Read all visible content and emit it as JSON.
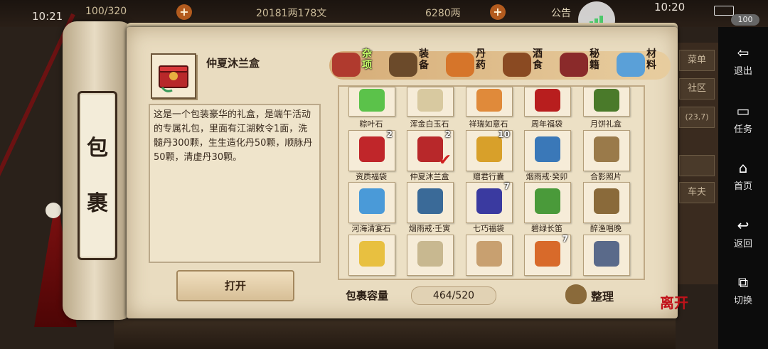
{
  "status_bar": {
    "time_left": "10:21",
    "time_right": "10:20",
    "battery": "100"
  },
  "hud": {
    "stamina": "100/320",
    "money": "20181两178文",
    "gold": "6280两",
    "announce": "公告"
  },
  "side_nav": [
    {
      "label": "退出",
      "icon": "exit-icon",
      "glyph": "⇦"
    },
    {
      "label": "任务",
      "icon": "tasks-icon",
      "glyph": "▭"
    },
    {
      "label": "首页",
      "icon": "home-icon",
      "glyph": "⌂"
    },
    {
      "label": "返回",
      "icon": "back-icon",
      "glyph": "↩"
    },
    {
      "label": "切换",
      "icon": "switch-icon",
      "glyph": "⧉"
    }
  ],
  "bg_tabs": [
    "菜单",
    "社区",
    "(23,7)",
    "",
    "车夫"
  ],
  "scroll": {
    "title_chars": [
      "包",
      "裹"
    ]
  },
  "selected_item": {
    "name": "仲夏沐兰盒",
    "description": "这是一个包装豪华的礼盒，是端午活动的专属礼包，里面有江湖敕令1面，洗髓丹300颗，生生造化丹50颗，顺脉丹50颗，清虚丹30颗。"
  },
  "open_button": "打开",
  "categories": [
    {
      "label": "杂项",
      "icon": "misc-jar-icon",
      "active": true,
      "color": "#b03a2e"
    },
    {
      "label": "装备",
      "icon": "equipment-weapon-icon",
      "active": false,
      "color": "#6b4a2a"
    },
    {
      "label": "丹药",
      "icon": "pill-plate-icon",
      "active": false,
      "color": "#d6752a"
    },
    {
      "label": "酒食",
      "icon": "wine-food-icon",
      "active": false,
      "color": "#8a4a22"
    },
    {
      "label": "秘籍",
      "icon": "scripture-book-icon",
      "active": false,
      "color": "#8a2a2a"
    },
    {
      "label": "材料",
      "icon": "crystal-material-icon",
      "active": false,
      "color": "#5aa0d8"
    }
  ],
  "grid_items": [
    {
      "name": "粽叶石",
      "count": "",
      "icon": "green-crystal-icon",
      "color": "#5bc24a",
      "selected": false
    },
    {
      "name": "浑金白玉石",
      "count": "",
      "icon": "white-jade-icon",
      "color": "#d8c9a0",
      "selected": false
    },
    {
      "name": "祥瑞如意石",
      "count": "",
      "icon": "flame-stone-icon",
      "color": "#e08a3a",
      "selected": false
    },
    {
      "name": "周年福袋",
      "count": "",
      "icon": "red-pouch-icon",
      "color": "#b81e1e",
      "selected": false
    },
    {
      "name": "月饼礼盒",
      "count": "",
      "icon": "mooncake-box-icon",
      "color": "#4a7a2a",
      "selected": false
    },
    {
      "name": "资质福袋",
      "count": "2",
      "icon": "lucky-bag-icon",
      "color": "#c0262a",
      "selected": false
    },
    {
      "name": "仲夏沐兰盒",
      "count": "2",
      "icon": "gift-box-icon",
      "color": "#b8282a",
      "selected": true
    },
    {
      "name": "赠君行囊",
      "count": "10",
      "icon": "gold-sack-icon",
      "color": "#d8a02a",
      "selected": false
    },
    {
      "name": "烟雨戒·癸卯",
      "count": "",
      "icon": "jade-ring-icon",
      "color": "#3a78b8",
      "selected": false
    },
    {
      "name": "合影照片",
      "count": "",
      "icon": "photo-frame-icon",
      "color": "#9a7a4a",
      "selected": false
    },
    {
      "name": "河海清宴石",
      "count": "",
      "icon": "blue-crystal-icon",
      "color": "#4a9ad8",
      "selected": false
    },
    {
      "name": "烟雨戒·壬寅",
      "count": "",
      "icon": "dragon-ring-icon",
      "color": "#3a6a98",
      "selected": false
    },
    {
      "name": "七巧福袋",
      "count": "7",
      "icon": "blue-pouch-icon",
      "color": "#3a3aa0",
      "selected": false
    },
    {
      "name": "碧绿长笛",
      "count": "",
      "icon": "green-flute-icon",
      "color": "#4a9a3a",
      "selected": false
    },
    {
      "name": "醉渔唱晚",
      "count": "",
      "icon": "book-icon",
      "color": "#8a6a3a",
      "selected": false
    },
    {
      "name": "",
      "count": "",
      "icon": "gold-coin-icon",
      "color": "#e8c040",
      "selected": false
    },
    {
      "name": "",
      "count": "",
      "icon": "tooth-pendant-icon",
      "color": "#c8b890",
      "selected": false
    },
    {
      "name": "",
      "count": "",
      "icon": "scroll-paper-icon",
      "color": "#c8a070",
      "selected": false
    },
    {
      "name": "",
      "count": "7",
      "icon": "orb-potion-icon",
      "color": "#d86a2a",
      "selected": false
    },
    {
      "name": "",
      "count": "",
      "icon": "iron-key-icon",
      "color": "#5a6a8a",
      "selected": false
    }
  ],
  "capacity": {
    "label": "包裹容量",
    "value": "464/520"
  },
  "sort_button": "整理",
  "leave_button": "离开"
}
